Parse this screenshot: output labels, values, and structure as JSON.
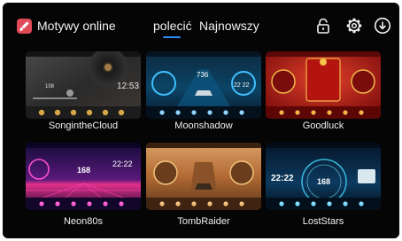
{
  "header": {
    "app_title": "Motywy online",
    "tabs": [
      {
        "label": "polecić",
        "active": true
      },
      {
        "label": "Najnowszy",
        "active": false
      }
    ],
    "icons": [
      "lock-icon",
      "gear-icon",
      "download-icon"
    ],
    "accent_color": "#2a8cf4",
    "app_icon_color": "#e04a58"
  },
  "themes": [
    {
      "name": "SongintheCloud",
      "time": "12:53",
      "num": "108"
    },
    {
      "name": "Moonshadow",
      "time": "22 22",
      "num": "736"
    },
    {
      "name": "Goodluck"
    },
    {
      "name": "Neon80s",
      "time": "22:22",
      "num": "168"
    },
    {
      "name": "TombRaider"
    },
    {
      "name": "LostStars",
      "time": "22:22",
      "num": "168"
    }
  ]
}
